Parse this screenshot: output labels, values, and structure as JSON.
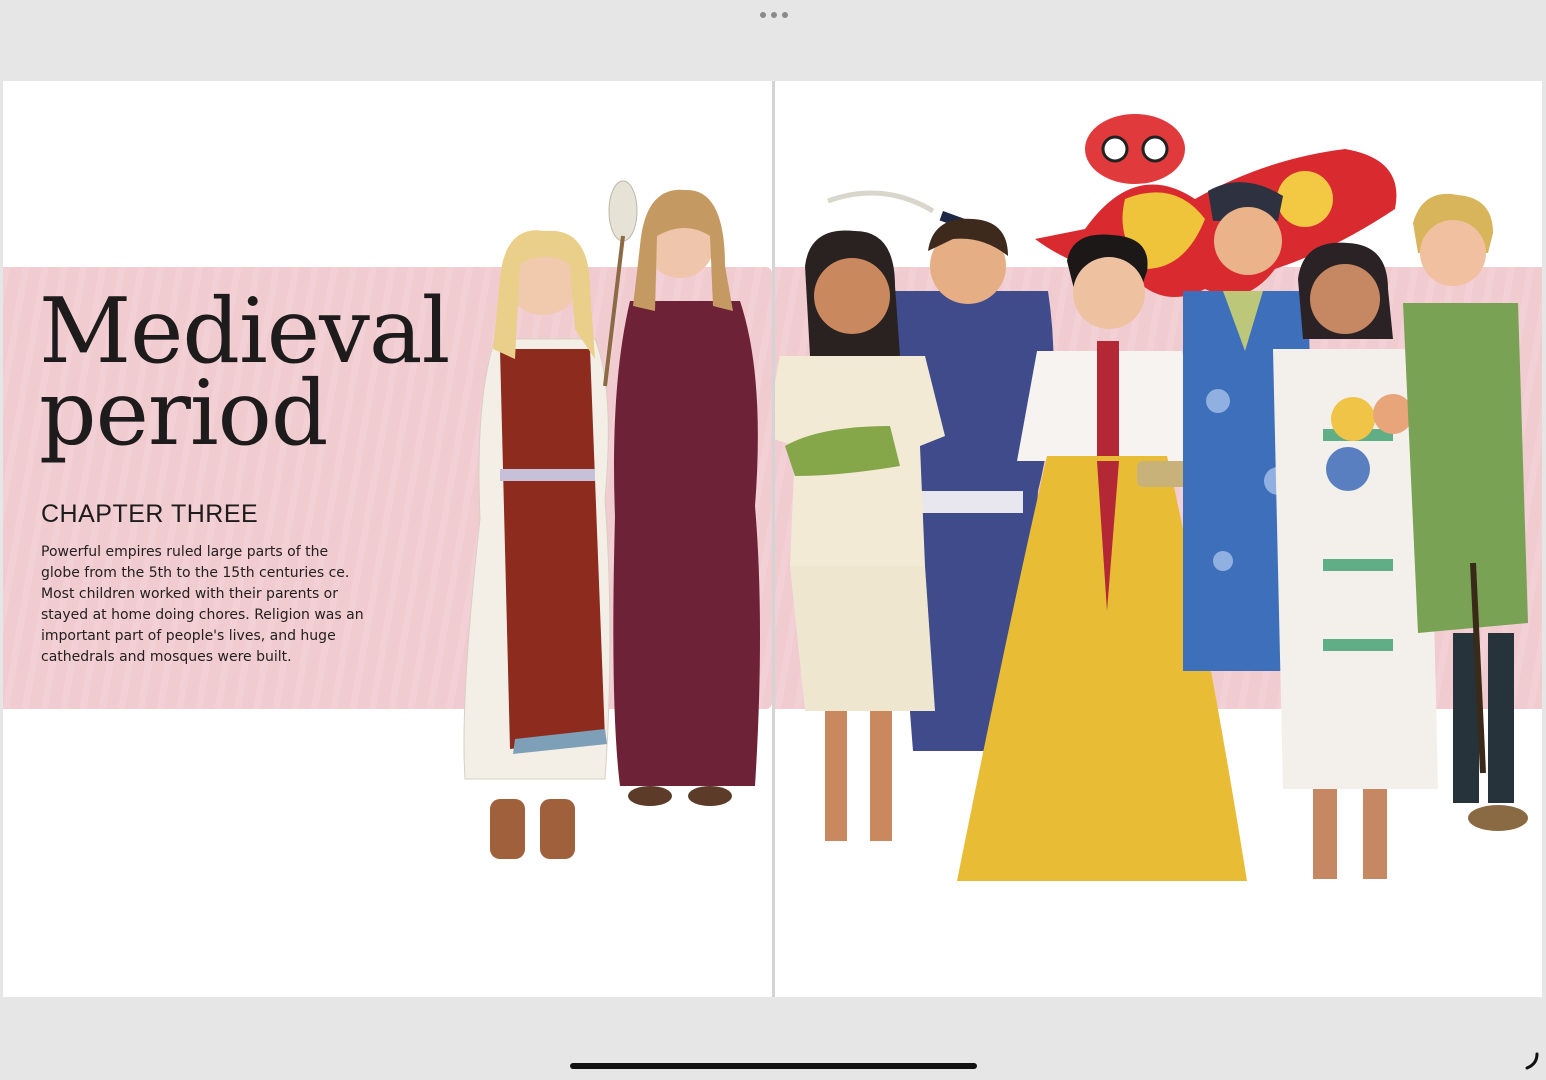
{
  "book": {
    "title": "Medieval period",
    "title_lines": [
      "Medieval",
      "period"
    ],
    "chapter_label": "CHAPTER THREE",
    "intro_text": "Powerful empires ruled large parts of the globe from the 5th to the 15th centuries ce. Most children worked with their parents or stayed at home doing chores. Religion was an important part of people's lives, and huge cathedrals and mosques were built."
  },
  "colors": {
    "background": "#e6e6e6",
    "page": "#ffffff",
    "pink_wash": "#f0cbd0",
    "title_text": "#1d1b1b"
  },
  "icons": {
    "top_handle": "ellipsis-icon",
    "bottom_right": "edit-corner-icon"
  }
}
